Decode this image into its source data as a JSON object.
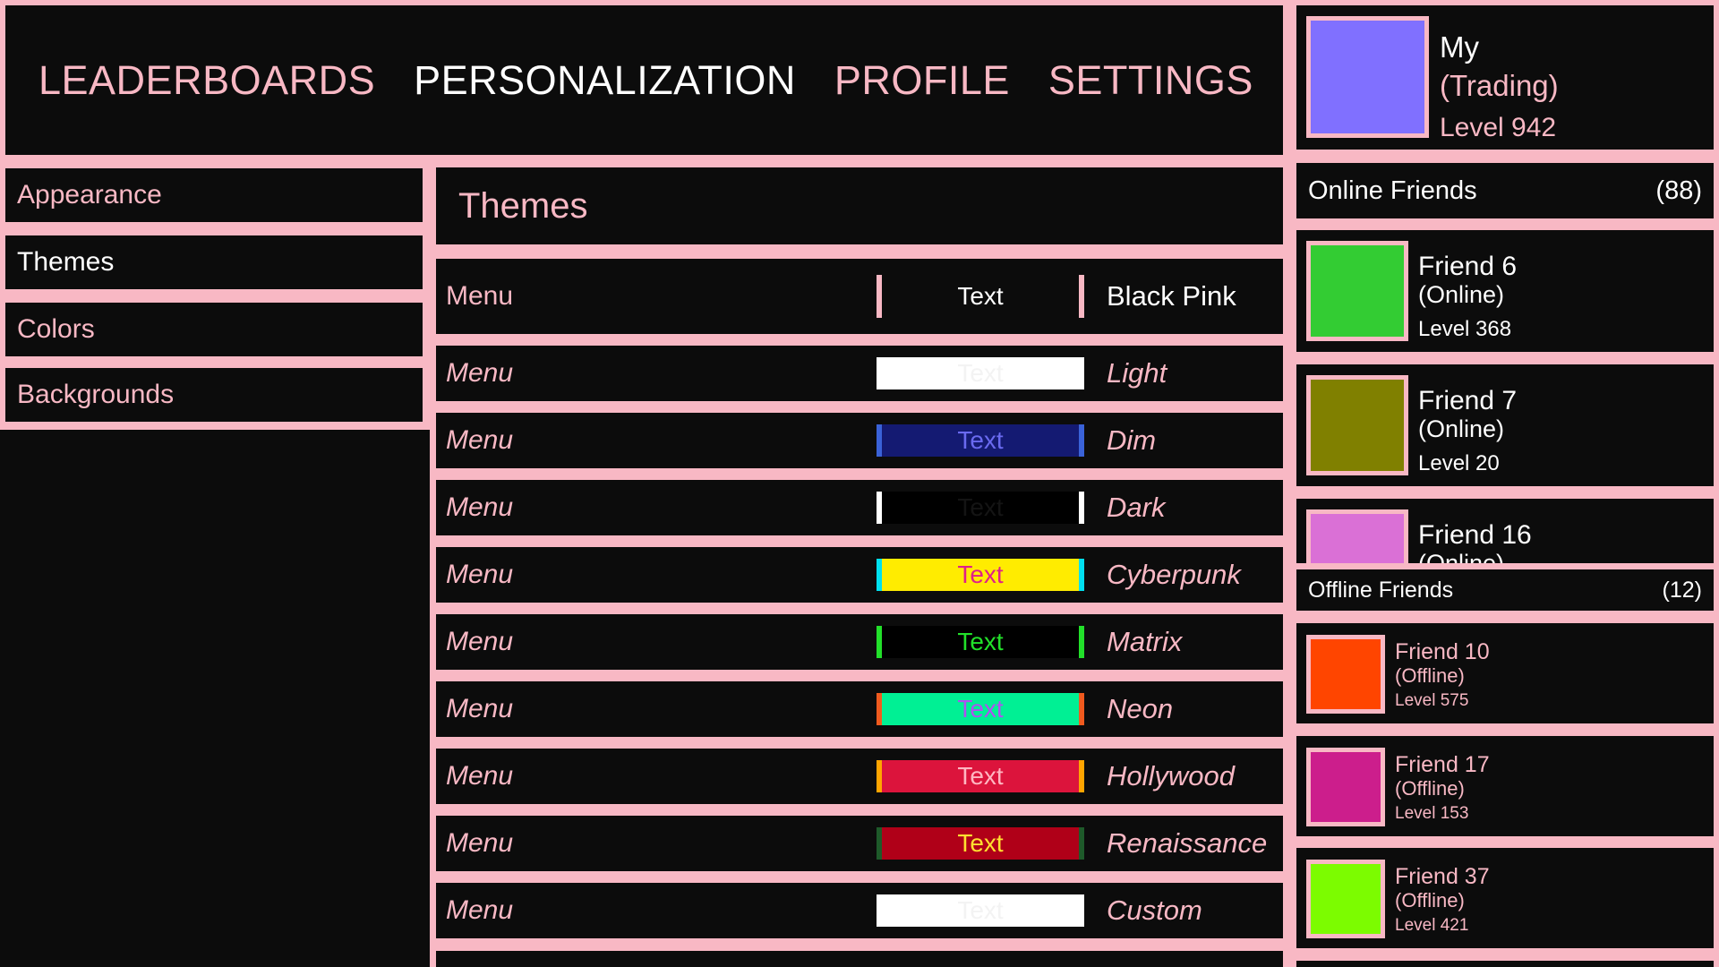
{
  "nav": {
    "items": [
      {
        "label": "LEADERBOARDS",
        "active": false
      },
      {
        "label": "PERSONALIZATION",
        "active": true
      },
      {
        "label": "PROFILE",
        "active": false
      },
      {
        "label": "SETTINGS",
        "active": false
      }
    ]
  },
  "sidebar": {
    "items": [
      {
        "label": "Appearance",
        "active": false
      },
      {
        "label": "Themes",
        "active": true
      },
      {
        "label": "Colors",
        "active": false
      },
      {
        "label": "Backgrounds",
        "active": false
      }
    ]
  },
  "themes": {
    "title": "Themes",
    "rows": [
      {
        "menu": "Menu",
        "swatch_text": "Text",
        "name": "Black Pink",
        "bg": "#0c0c0c",
        "fg": "#ffffff",
        "edge": "#f8b8c4",
        "active": true
      },
      {
        "menu": "Menu",
        "swatch_text": "Text",
        "name": "Light",
        "bg": "#ffffff",
        "fg": "#f3f3f3",
        "edge": "#ffffff",
        "active": false
      },
      {
        "menu": "Menu",
        "swatch_text": "Text",
        "name": "Dim",
        "bg": "#141a72",
        "fg": "#6a6af0",
        "edge": "#3a62d8",
        "active": false
      },
      {
        "menu": "Menu",
        "swatch_text": "Text",
        "name": "Dark",
        "bg": "#000000",
        "fg": "#141414",
        "edge": "#ffffff",
        "active": false
      },
      {
        "menu": "Menu",
        "swatch_text": "Text",
        "name": "Cyberpunk",
        "bg": "#ffec00",
        "fg": "#e0208a",
        "edge": "#00e0f0",
        "active": false
      },
      {
        "menu": "Menu",
        "swatch_text": "Text",
        "name": "Matrix",
        "bg": "#000000",
        "fg": "#22e02a",
        "edge": "#22e02a",
        "active": false
      },
      {
        "menu": "Menu",
        "swatch_text": "Text",
        "name": "Neon",
        "bg": "#00f094",
        "fg": "#b050f0",
        "edge": "#f05a1e",
        "active": false
      },
      {
        "menu": "Menu",
        "swatch_text": "Text",
        "name": "Hollywood",
        "bg": "#dc143c",
        "fg": "#ffb6c1",
        "edge": "#ffa500",
        "active": false
      },
      {
        "menu": "Menu",
        "swatch_text": "Text",
        "name": "Renaissance",
        "bg": "#b00018",
        "fg": "#ffe030",
        "edge": "#1e5a2a",
        "active": false
      },
      {
        "menu": "Menu",
        "swatch_text": "Text",
        "name": "Custom",
        "bg": "#ffffff",
        "fg": "#f3f3f3",
        "edge": "#ffffff",
        "active": false
      }
    ]
  },
  "profile": {
    "name": "My",
    "status": "(Trading)",
    "level": "Level 942",
    "avatar_color": "#8070ff"
  },
  "online_friends": {
    "title": "Online Friends",
    "count": "(88)",
    "friends": [
      {
        "name": "Friend 6",
        "status": "(Online)",
        "level": "Level 368",
        "color": "#33cc33"
      },
      {
        "name": "Friend 7",
        "status": "(Online)",
        "level": "Level 20",
        "color": "#808000"
      },
      {
        "name": "Friend 16",
        "status": "(Online)",
        "level": "",
        "color": "#da70d6"
      }
    ]
  },
  "offline_friends": {
    "title": "Offline Friends",
    "count": "(12)",
    "friends": [
      {
        "name": "Friend 10",
        "status": "(Offline)",
        "level": "Level 575",
        "color": "#ff4500"
      },
      {
        "name": "Friend 17",
        "status": "(Offline)",
        "level": "Level 153",
        "color": "#cc1e8c"
      },
      {
        "name": "Friend 37",
        "status": "(Offline)",
        "level": "Level 421",
        "color": "#7cfc00"
      }
    ]
  },
  "colors": {
    "accent_pink": "#f8b8c4",
    "panel_bg": "#0c0c0c",
    "text_active": "#ffffff"
  }
}
